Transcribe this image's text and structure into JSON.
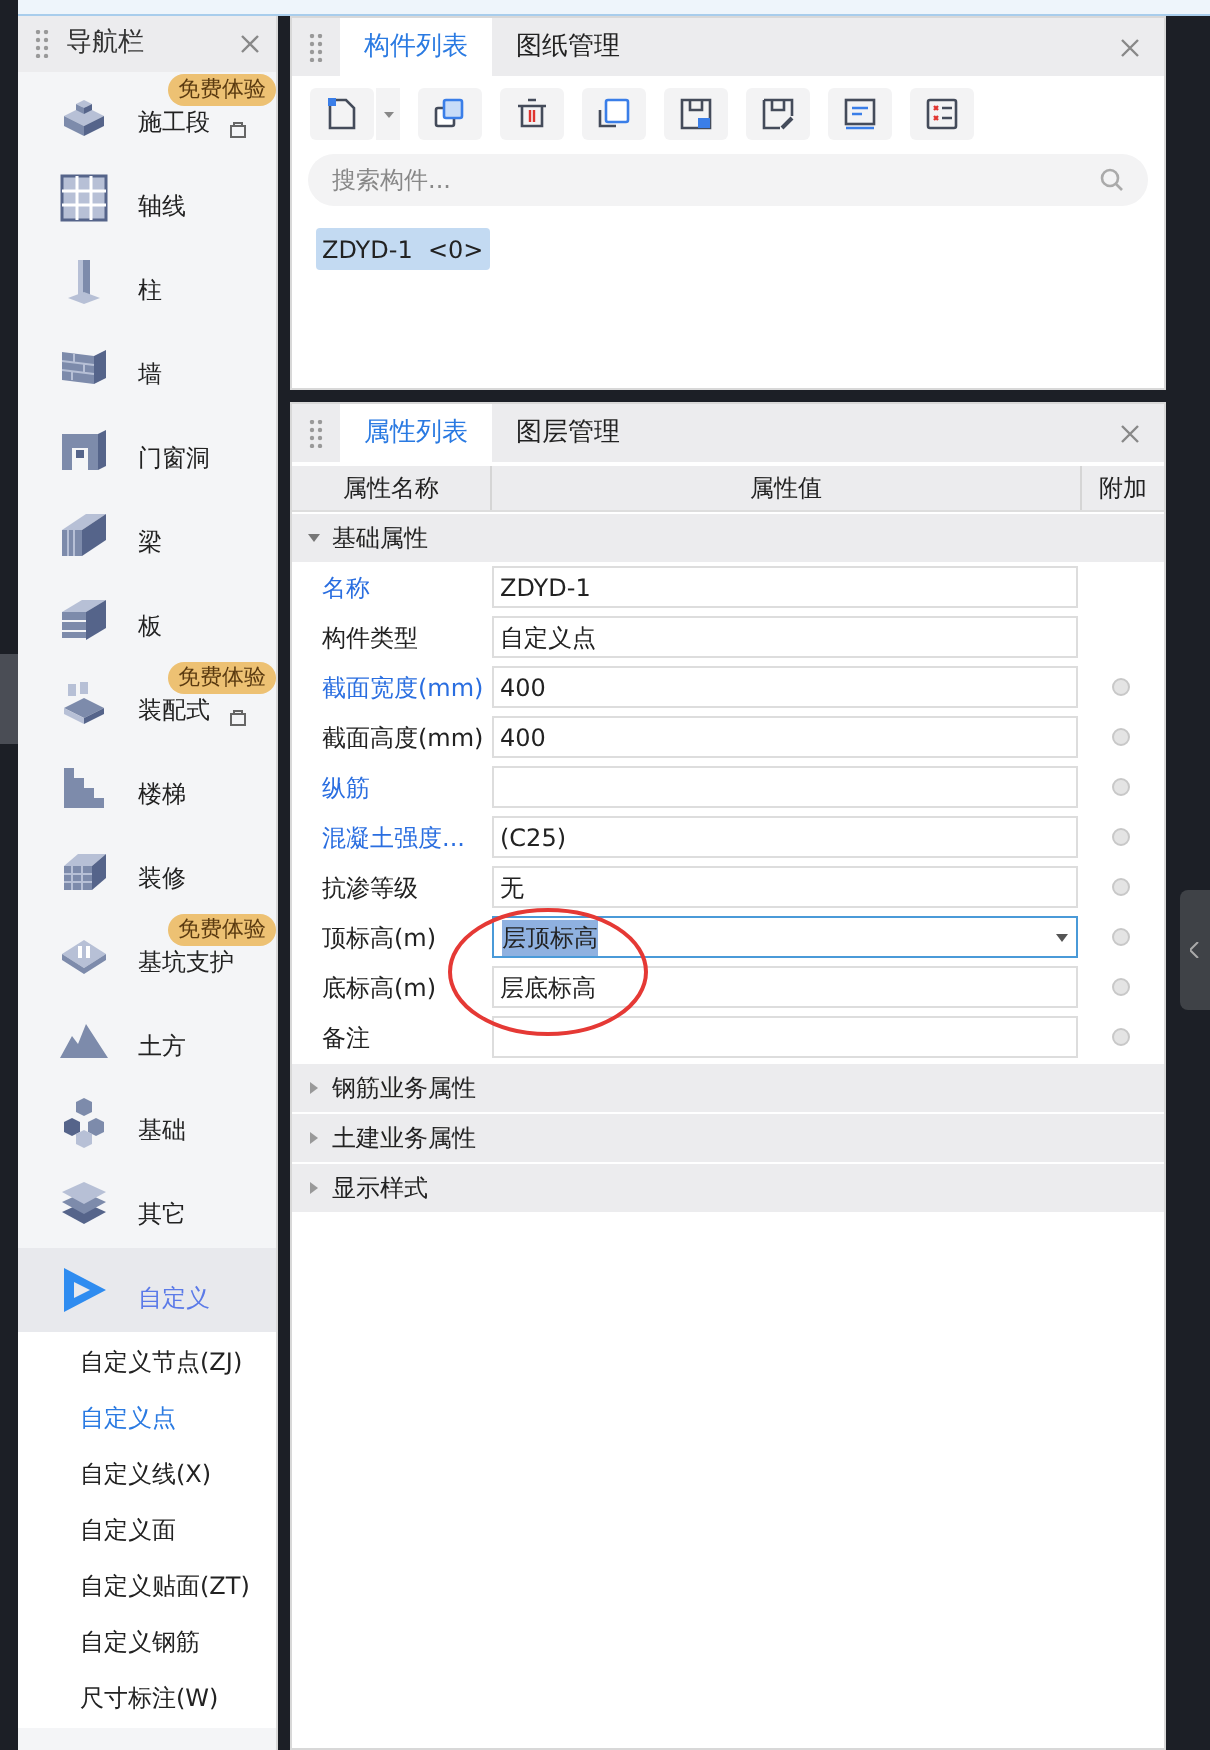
{
  "nav": {
    "title": "导航栏",
    "items": [
      {
        "label": "施工段",
        "badge": "免费体验",
        "locked": true,
        "selected": false
      },
      {
        "label": "轴线",
        "selected": false
      },
      {
        "label": "柱",
        "selected": false
      },
      {
        "label": "墙",
        "selected": false
      },
      {
        "label": "门窗洞",
        "selected": false
      },
      {
        "label": "梁",
        "selected": false
      },
      {
        "label": "板",
        "selected": false
      },
      {
        "label": "装配式",
        "badge": "免费体验",
        "locked": true,
        "selected": false
      },
      {
        "label": "楼梯",
        "selected": false
      },
      {
        "label": "装修",
        "selected": false
      },
      {
        "label": "基坑支护",
        "badge": "免费体验",
        "locked": false,
        "selected": false
      },
      {
        "label": "土方",
        "selected": false
      },
      {
        "label": "基础",
        "selected": false
      },
      {
        "label": "其它",
        "selected": false
      },
      {
        "label": "自定义",
        "selected": true
      }
    ],
    "sub_items": [
      {
        "label": "自定义节点(ZJ)",
        "selected": false
      },
      {
        "label": "自定义点",
        "selected": true
      },
      {
        "label": "自定义线(X)",
        "selected": false
      },
      {
        "label": "自定义面",
        "selected": false
      },
      {
        "label": "自定义贴面(ZT)",
        "selected": false
      },
      {
        "label": "自定义钢筋",
        "selected": false
      },
      {
        "label": "尺寸标注(W)",
        "selected": false
      }
    ]
  },
  "component_panel": {
    "tabs": [
      {
        "label": "构件列表",
        "selected": true
      },
      {
        "label": "图纸管理",
        "selected": false
      }
    ],
    "toolbar": [
      {
        "kind": "new",
        "dropdown": true
      },
      {
        "kind": "copy",
        "dropdown": false
      },
      {
        "kind": "delete",
        "dropdown": false
      },
      {
        "kind": "duplicate",
        "dropdown": false
      },
      {
        "kind": "save",
        "dropdown": false
      },
      {
        "kind": "pick",
        "dropdown": false
      },
      {
        "kind": "align",
        "dropdown": false
      },
      {
        "kind": "checklist",
        "dropdown": false
      }
    ],
    "search": {
      "placeholder": "搜索构件..."
    },
    "components": [
      {
        "label": "ZDYD-1  <0>",
        "selected": true
      }
    ]
  },
  "property_panel": {
    "tabs": [
      {
        "label": "属性列表",
        "selected": true
      },
      {
        "label": "图层管理",
        "selected": false
      }
    ],
    "columns": [
      "属性名称",
      "属性值",
      "附加"
    ],
    "groups": [
      {
        "title": "基础属性",
        "expanded": true,
        "rows": [
          {
            "name": "名称",
            "linked": true,
            "kind": "text",
            "value": "ZDYD-1",
            "has_option": false
          },
          {
            "name": "构件类型",
            "linked": false,
            "kind": "text",
            "value": "自定义点",
            "has_option": false
          },
          {
            "name": "截面宽度(mm)",
            "linked": true,
            "kind": "text",
            "value": "400",
            "has_option": true
          },
          {
            "name": "截面高度(mm)",
            "linked": false,
            "kind": "text",
            "value": "400",
            "has_option": true
          },
          {
            "name": "纵筋",
            "linked": true,
            "kind": "text",
            "value": "",
            "has_option": true
          },
          {
            "name": "混凝土强度...",
            "linked": true,
            "kind": "text",
            "value": "(C25)",
            "has_option": true
          },
          {
            "name": "抗渗等级",
            "linked": false,
            "kind": "text",
            "value": "无",
            "has_option": true
          },
          {
            "name": "顶标高(m)",
            "linked": false,
            "kind": "dropdown",
            "value": "层顶标高",
            "has_option": true,
            "selected": true
          },
          {
            "name": "底标高(m)",
            "linked": false,
            "kind": "text",
            "value": "层底标高",
            "has_option": true
          },
          {
            "name": "备注",
            "linked": false,
            "kind": "text",
            "value": "",
            "has_option": true
          }
        ]
      },
      {
        "title": "钢筋业务属性",
        "expanded": false
      },
      {
        "title": "土建业务属性",
        "expanded": false
      },
      {
        "title": "显示样式",
        "expanded": false
      }
    ]
  }
}
